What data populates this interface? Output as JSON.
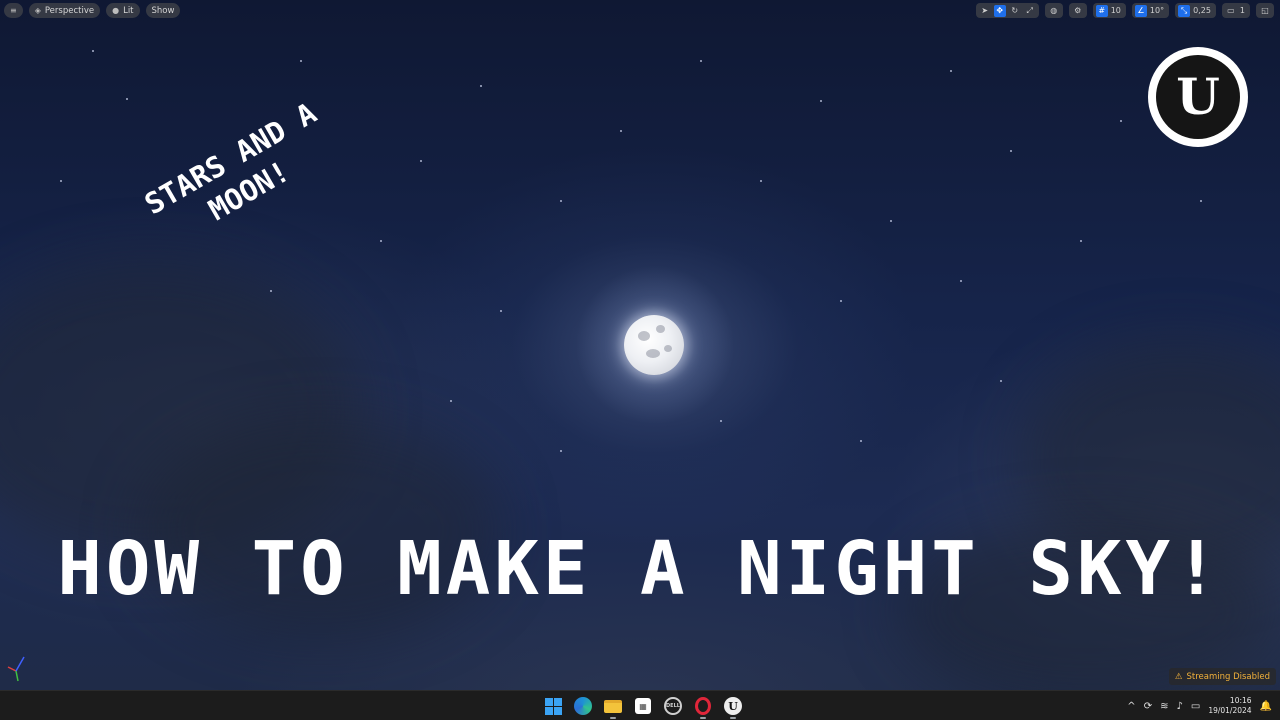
{
  "viewport_toolbar": {
    "menu_icon": "hamburger-icon",
    "perspective_label": "Perspective",
    "lit_label": "Lit",
    "show_label": "Show",
    "grid_snap_value": "10",
    "rotation_snap_value": "10°",
    "scale_snap_value": "0,25",
    "camera_speed_value": "1"
  },
  "overlay": {
    "subtitle_line1": "STARS AND A",
    "subtitle_line2": "MOON!",
    "main_title": "HOW TO MAKE A NIGHT SKY!",
    "logo_letter": "U"
  },
  "status": {
    "streaming_label": "Streaming Disabled"
  },
  "taskbar": {
    "apps": [
      "start",
      "edge",
      "file-explorer",
      "microsoft-store",
      "dell",
      "opera",
      "unreal-engine"
    ],
    "store_glyph": "▦",
    "dell_label": "DELL",
    "ue_label": "U",
    "tray_chevron": "^",
    "time": "10:16",
    "date": "19/01/2024"
  },
  "colors": {
    "accent_blue": "#1f6feb",
    "warning_yellow": "#f2b13a",
    "taskbar_bg": "#1c1c1c",
    "sky_dark": "#0f1833"
  }
}
